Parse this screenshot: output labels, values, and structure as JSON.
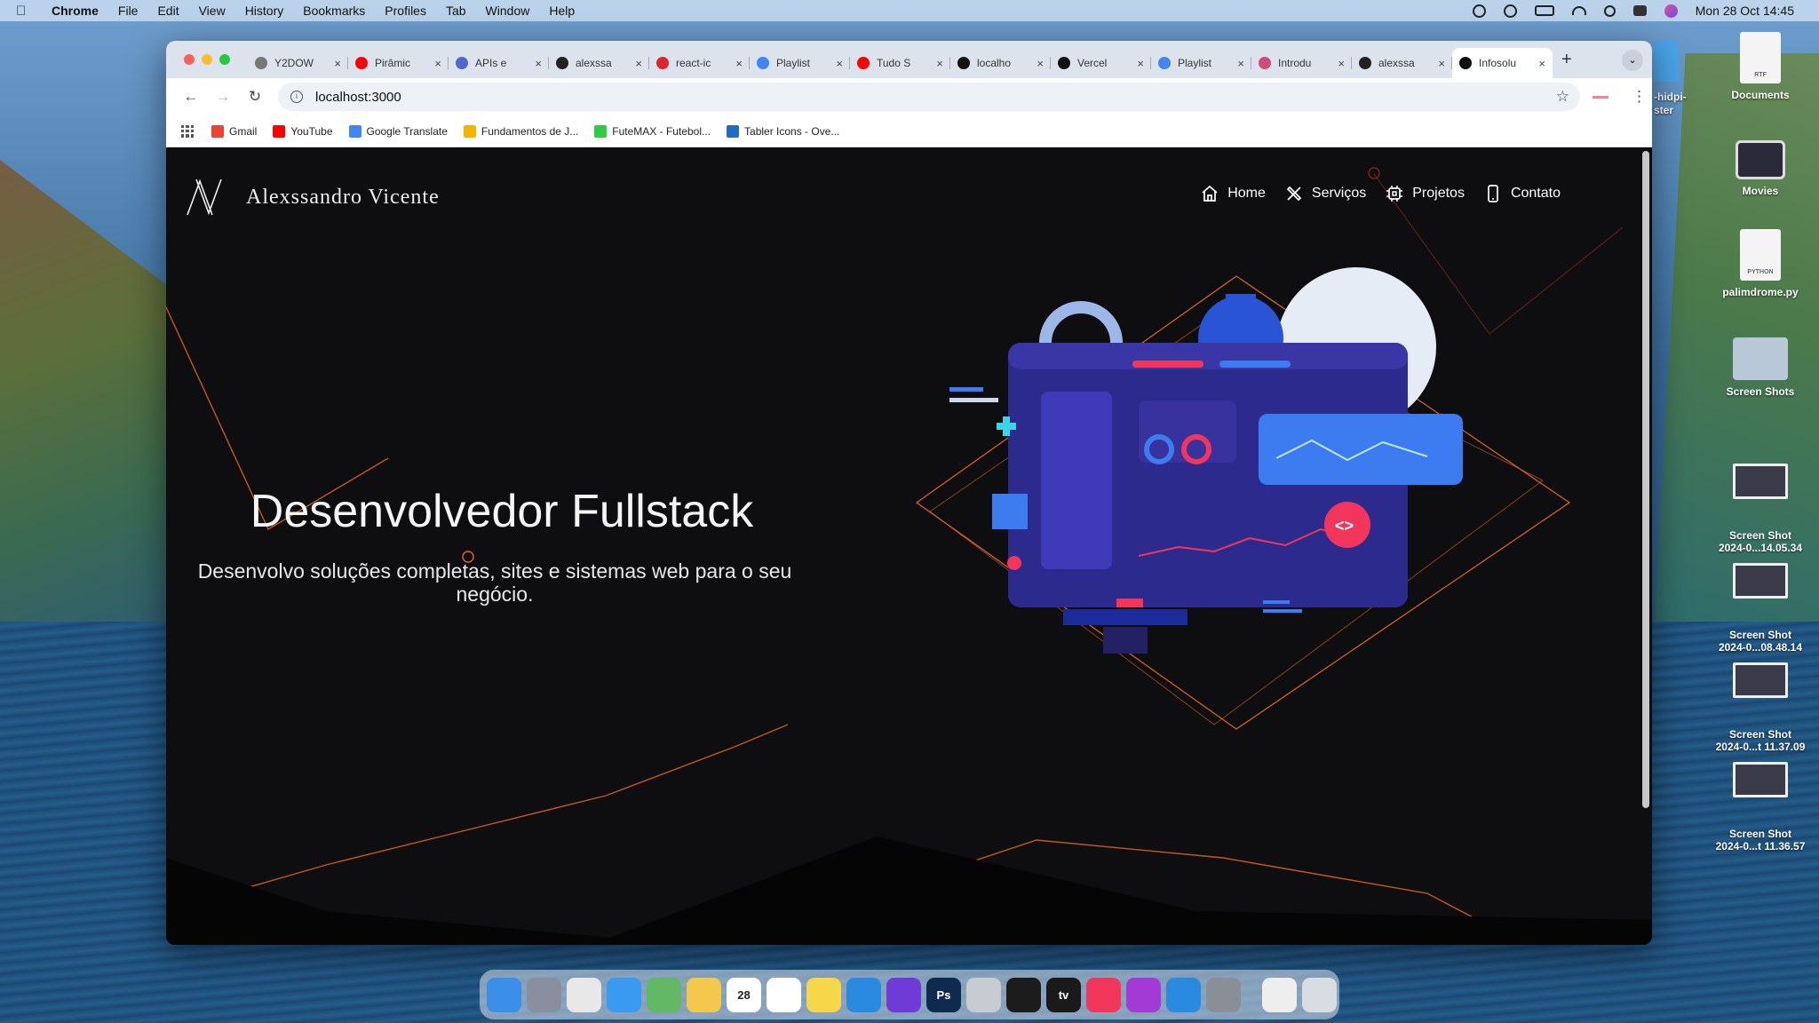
{
  "menubar": {
    "app_name": "Chrome",
    "items": [
      "File",
      "Edit",
      "View",
      "History",
      "Bookmarks",
      "Profiles",
      "Tab",
      "Window",
      "Help"
    ],
    "clock": "Mon 28 Oct  14:45"
  },
  "desktop": {
    "partial_label": "-hidpi-\nster",
    "icons": [
      {
        "label": "Documents",
        "kind": "doc",
        "badge": "RTF"
      },
      {
        "label": "Movies",
        "kind": "movie"
      },
      {
        "label": "palimdrome.py",
        "kind": "doc",
        "badge": "PYTHON"
      },
      {
        "label": "Screen Shots",
        "kind": "folder"
      },
      {
        "label": "Screen Shot\n2024-0...14.05.34",
        "kind": "shot"
      },
      {
        "label": "Screen Shot\n2024-0...08.48.14",
        "kind": "shot"
      },
      {
        "label": "Screen Shot\n2024-0...t 11.37.09",
        "kind": "shot"
      },
      {
        "label": "Screen Shot\n2024-0...t 11.36.57",
        "kind": "shot"
      }
    ]
  },
  "browser": {
    "tabs": [
      {
        "title": "Y2DOW",
        "icon": "globe-icon",
        "color": "#777777"
      },
      {
        "title": "Pirâmic",
        "icon": "youtube-icon",
        "color": "#ff0000"
      },
      {
        "title": "APIs e",
        "icon": "api-icon",
        "color": "#5566cc"
      },
      {
        "title": "alexssa",
        "icon": "github-icon",
        "color": "#222222"
      },
      {
        "title": "react-ic",
        "icon": "react-icons-icon",
        "color": "#e0242e"
      },
      {
        "title": "Playlist",
        "icon": "google-icon",
        "color": "#4285f4"
      },
      {
        "title": "Tudo S",
        "icon": "youtube-icon",
        "color": "#ff0000"
      },
      {
        "title": "localho",
        "icon": "vercel-icon",
        "color": "#111111"
      },
      {
        "title": "Vercel",
        "icon": "vercel-icon",
        "color": "#111111"
      },
      {
        "title": "Playlist",
        "icon": "google-icon",
        "color": "#4285f4"
      },
      {
        "title": "Introdu",
        "icon": "site-icon",
        "color": "#d04a7a"
      },
      {
        "title": "alexssa",
        "icon": "github-icon",
        "color": "#222222"
      },
      {
        "title": "Infosolu",
        "icon": "vercel-icon",
        "color": "#111111",
        "active": true
      }
    ],
    "url": "localhost:3000",
    "bookmarks": [
      {
        "label": "Gmail",
        "color": "#ea4335"
      },
      {
        "label": "YouTube",
        "color": "#ff0000"
      },
      {
        "label": "Google Translate",
        "color": "#4285f4"
      },
      {
        "label": "Fundamentos de J...",
        "color": "#f4b400"
      },
      {
        "label": "FuteMAX - Futebol...",
        "color": "#2ecc40"
      },
      {
        "label": "Tabler Icons - Ove...",
        "color": "#206bc4"
      }
    ]
  },
  "site": {
    "brand": "Alexssandro Vicente",
    "nav": [
      {
        "label": "Home",
        "icon": "home-icon"
      },
      {
        "label": "Serviços",
        "icon": "tools-icon"
      },
      {
        "label": "Projetos",
        "icon": "cpu-icon"
      },
      {
        "label": "Contato",
        "icon": "phone-icon"
      }
    ],
    "hero_title": "Desenvolvedor Fullstack",
    "hero_subtitle": "Desenvolvo soluções completas, sites e sistemas web para o seu negócio.",
    "accent_color": "#e0672a"
  },
  "dock": {
    "apps": [
      {
        "name": "Finder",
        "color": "#3b8fe8"
      },
      {
        "name": "Launchpad",
        "color": "#8a8fa0"
      },
      {
        "name": "Chrome",
        "color": "#e8e8e8"
      },
      {
        "name": "Mail",
        "color": "#3a9af2"
      },
      {
        "name": "Maps",
        "color": "#62b864"
      },
      {
        "name": "Photos",
        "color": "#f2c94c"
      },
      {
        "name": "Calendar",
        "color": "#ffffff",
        "text": "28"
      },
      {
        "name": "Reminders",
        "color": "#ffffff"
      },
      {
        "name": "Notes",
        "color": "#f7d74a"
      },
      {
        "name": "VS Code",
        "color": "#2a8ae0"
      },
      {
        "name": "Notion",
        "color": "#6f3ad6"
      },
      {
        "name": "Photoshop",
        "color": "#0f2a4e",
        "text": "Ps"
      },
      {
        "name": "Disk Utility",
        "color": "#c7cbd2"
      },
      {
        "name": "Vectorize",
        "color": "#1c1c1c"
      },
      {
        "name": "TV",
        "color": "#1a1a1a",
        "text": "tv"
      },
      {
        "name": "Music",
        "color": "#f2365b"
      },
      {
        "name": "Podcasts",
        "color": "#a33ad6"
      },
      {
        "name": "App Store",
        "color": "#2a8ae0"
      },
      {
        "name": "System Settings",
        "color": "#8a8e96"
      },
      {
        "name": "Documents Stack",
        "color": "#eeeeee"
      },
      {
        "name": "Trash",
        "color": "#d8dde4"
      }
    ]
  }
}
